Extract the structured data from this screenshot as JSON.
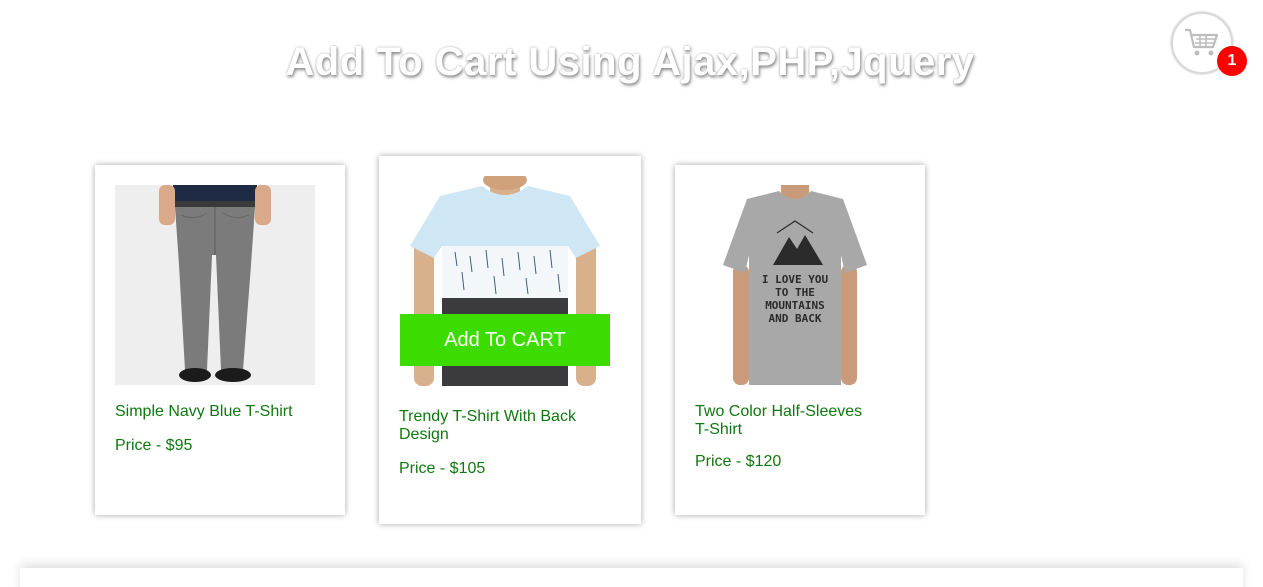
{
  "header": {
    "title": "Add To Cart Using Ajax,PHP,Jquery"
  },
  "cart": {
    "icon": "shopping-cart-icon",
    "count": "1",
    "badge_color": "#ff0000"
  },
  "products": [
    {
      "name": "Simple Navy Blue T-Shirt",
      "price": "Price - $95",
      "image": "grey-pants-photo"
    },
    {
      "name": "Trendy T-Shirt With Back Design",
      "price": "Price - $105",
      "image": "striped-tshirt-photo",
      "add_button_label": "Add To CART"
    },
    {
      "name": "Two Color Half-Sleeves T-Shirt",
      "price": "Price - $120",
      "image": "grey-mountains-tshirt-photo",
      "shirt_text": "I LOVE YOU TO THE MOUNTAINS AND BACK"
    }
  ],
  "colors": {
    "text_green": "#107810",
    "button_green": "#3ddc00"
  }
}
